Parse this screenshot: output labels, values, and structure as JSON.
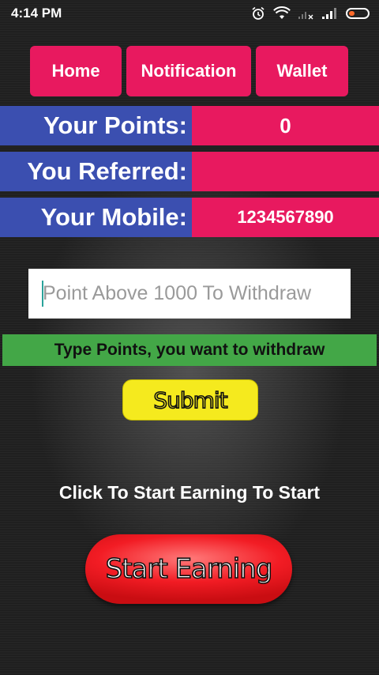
{
  "status_bar": {
    "time": "4:14 PM",
    "icons": [
      "alarm-icon",
      "wifi-icon",
      "signal-icon",
      "battery-icon"
    ],
    "battery_color": "#ff6a2a"
  },
  "nav": {
    "home": "Home",
    "notification": "Notification",
    "wallet": "Wallet"
  },
  "info": {
    "points_label": "Your Points:",
    "points_value": "0",
    "referred_label": "You Referred:",
    "referred_value": "",
    "mobile_label": "Your Mobile:",
    "mobile_value": "1234567890"
  },
  "withdraw": {
    "placeholder": "Point Above 1000 To Withdraw",
    "value": "",
    "hint": "Type Points, you want to withdraw",
    "submit_label": "Submit"
  },
  "earning": {
    "cta_text": "Click To Start Earning To Start",
    "start_label": "Start Earning"
  },
  "colors": {
    "accent_pink": "#e8195f",
    "label_blue": "#3b4fb0",
    "hint_green": "#43a747",
    "submit_yellow": "#f5ea1e",
    "start_red": "#f21c24"
  }
}
